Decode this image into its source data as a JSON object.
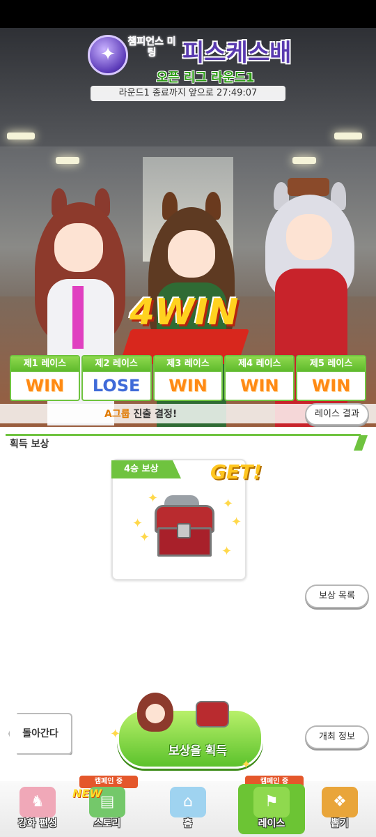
{
  "event": {
    "name_small": "챔피언스 미팅",
    "title": "피스케스배",
    "league_round": "오픈 리그 라운드1",
    "timer": "라운드1 종료까지 앞으로 27:49:07"
  },
  "summary": {
    "wins": "4WIN"
  },
  "races": [
    {
      "label": "제1 레이스",
      "result": "WIN"
    },
    {
      "label": "제2 레이스",
      "result": "LOSE"
    },
    {
      "label": "제3 레이스",
      "result": "WIN"
    },
    {
      "label": "제4 레이스",
      "result": "WIN"
    },
    {
      "label": "제5 레이스",
      "result": "WIN"
    }
  ],
  "advance": {
    "group": "A그룹",
    "text": "진출 결정!",
    "result_button": "레이스 결과"
  },
  "rewards": {
    "section_title": "획득 보상",
    "card_tag": "4승 보상",
    "get_label": "GET!",
    "list_button": "보상 목록",
    "info_button": "개최 정보"
  },
  "actions": {
    "back": "돌아간다",
    "claim": "보상을 획득"
  },
  "nav": [
    {
      "label": "강화 편성",
      "icon": "training-icon",
      "color": "#f0a8b8"
    },
    {
      "label": "스토리",
      "icon": "story-icon",
      "color": "#74c86a",
      "campaign": "캠페인 중",
      "new": "NEW"
    },
    {
      "label": "홈",
      "icon": "home-icon",
      "color": "#9fd3f0"
    },
    {
      "label": "레이스",
      "icon": "race-icon",
      "color": "#6cc434",
      "campaign": "캠페인 중"
    },
    {
      "label": "뽑기",
      "icon": "gacha-icon",
      "color": "#e9a53a"
    }
  ],
  "colors": {
    "accent_green": "#6fc33f",
    "win_orange": "#ff8a14",
    "lose_blue": "#3f6ad8"
  }
}
